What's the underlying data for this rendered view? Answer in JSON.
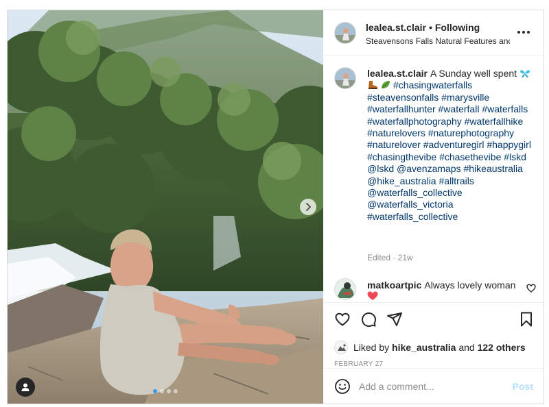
{
  "post": {
    "username": "lealea.st.clair",
    "separator": "•",
    "follow_status": "Following",
    "location": "Steavensons Falls Natural Features and Sc",
    "image": {
      "carousel_count": 4,
      "active_index": 0
    }
  },
  "caption": {
    "username": "lealea.st.clair",
    "text": "A Sunday well spent",
    "emojis": [
      "butterfly",
      "hiking-boot",
      "leaf"
    ],
    "hashtags": [
      "#chasingwaterfalls",
      "#steavensonfalls",
      "#marysville",
      "#waterfallhunter",
      "#waterfall",
      "#waterfalls",
      "#waterfallphotography",
      "#waterfallhike",
      "#naturelovers",
      "#naturephotography",
      "#naturelover",
      "#adventuregirl",
      "#happygirl",
      "#chasingthevibe",
      "#chasethevibe",
      "#lskd",
      "@lskd",
      "@avenzamaps",
      "#hikeaustralia",
      "@hike_australia",
      "#alltrails",
      "@waterfalls_collective",
      "@waterfalls_victoria",
      "#waterfalls_collective"
    ],
    "edited_label": "Edited · 21w"
  },
  "comment": {
    "username": "matkoartpic",
    "text": "Always lovely woman",
    "emoji": "red-heart"
  },
  "likes": {
    "prefix": "Liked by",
    "liker": "hike_australia",
    "and_word": "and",
    "others": "122 others"
  },
  "date": "FEBRUARY 27",
  "add_comment": {
    "placeholder": "Add a comment...",
    "post_label": "Post"
  },
  "colors": {
    "link": "#00376b",
    "muted": "#8e8e8e",
    "post_disabled": "#b2dffc",
    "carousel_active": "#3897f0",
    "heart": "#ed4956"
  }
}
